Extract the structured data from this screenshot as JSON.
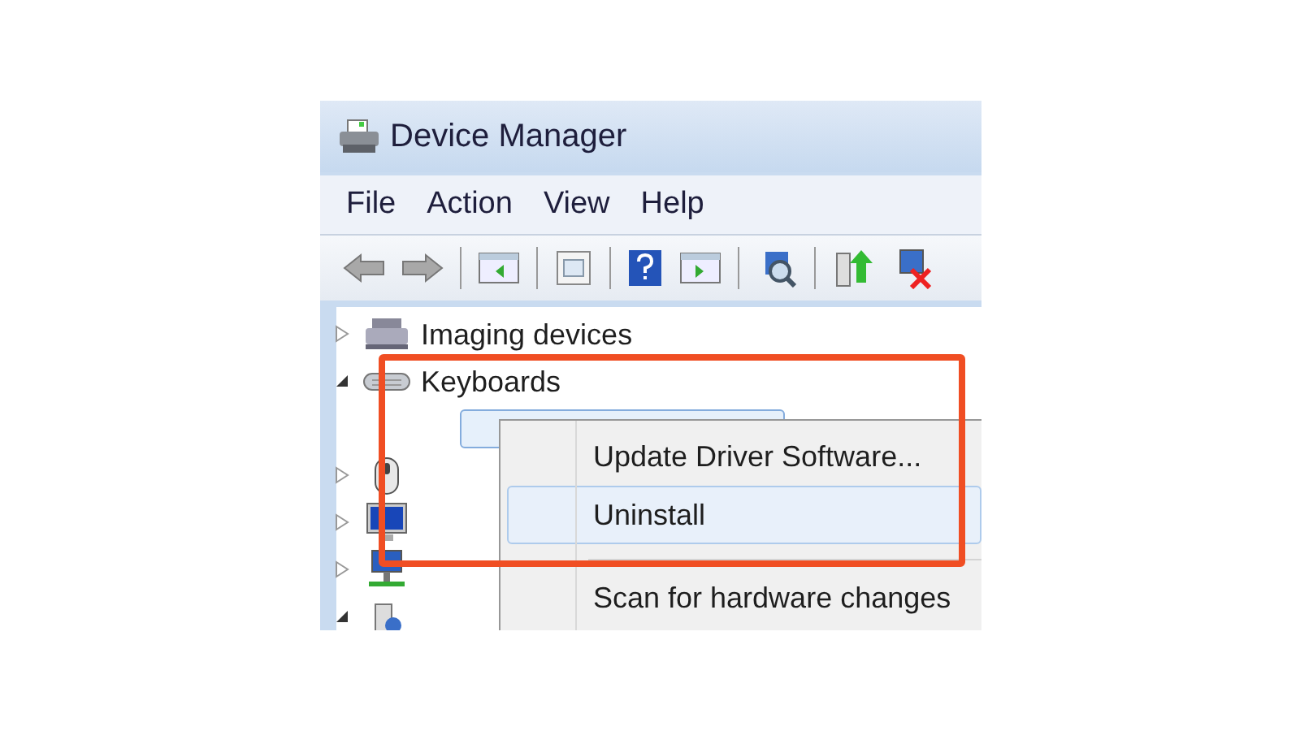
{
  "window": {
    "title": "Device Manager"
  },
  "menu": [
    {
      "label": "File"
    },
    {
      "label": "Action"
    },
    {
      "label": "View"
    },
    {
      "label": "Help"
    }
  ],
  "tree": [
    {
      "kind": "imaging",
      "label": "Imaging devices",
      "expanded": false
    },
    {
      "kind": "keyboard",
      "label": "Keyboards",
      "expanded": true,
      "children": [
        {
          "selected": true
        }
      ]
    },
    {
      "kind": "mouse",
      "expanded": false
    },
    {
      "kind": "monitor",
      "expanded": false
    },
    {
      "kind": "network",
      "expanded": false
    },
    {
      "kind": "other",
      "expanded": true
    }
  ],
  "context_menu": [
    {
      "kind": "item",
      "label": "Update Driver Software...",
      "selected": false
    },
    {
      "kind": "item",
      "label": "Uninstall",
      "selected": true
    },
    {
      "kind": "separator"
    },
    {
      "kind": "item",
      "label": "Scan for hardware changes",
      "selected": false
    }
  ]
}
